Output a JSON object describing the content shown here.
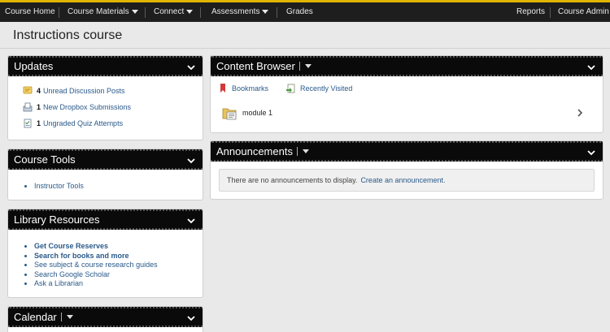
{
  "nav": {
    "course_home": "Course Home",
    "course_materials": "Course Materials",
    "connect": "Connect",
    "assessments": "Assessments",
    "grades": "Grades",
    "reports": "Reports",
    "course_admin": "Course Admin"
  },
  "page_title": "Instructions course",
  "updates": {
    "title": "Updates",
    "items": [
      {
        "count": "4",
        "label": "Unread Discussion Posts"
      },
      {
        "count": "1",
        "label": "New Dropbox Submissions"
      },
      {
        "count": "1",
        "label": "Ungraded Quiz Attempts"
      }
    ]
  },
  "course_tools": {
    "title": "Course Tools",
    "items": [
      "Instructor Tools"
    ]
  },
  "library": {
    "title": "Library Resources",
    "items": [
      "Get Course Reserves",
      "Search for books and more",
      "See subject & course research guides",
      "Search Google Scholar",
      "Ask a Librarian"
    ]
  },
  "calendar": {
    "title": "Calendar"
  },
  "content_browser": {
    "title": "Content Browser",
    "bookmarks": "Bookmarks",
    "recently_visited": "Recently Visited",
    "module": "module 1"
  },
  "announcements": {
    "title": "Announcements",
    "empty_text": "There are no announcements to display.",
    "create_link": "Create an announcement."
  },
  "colors": {
    "accent_bar": "#e1b400",
    "link": "#2a5a8a",
    "header_bg": "#0a0a0a"
  }
}
